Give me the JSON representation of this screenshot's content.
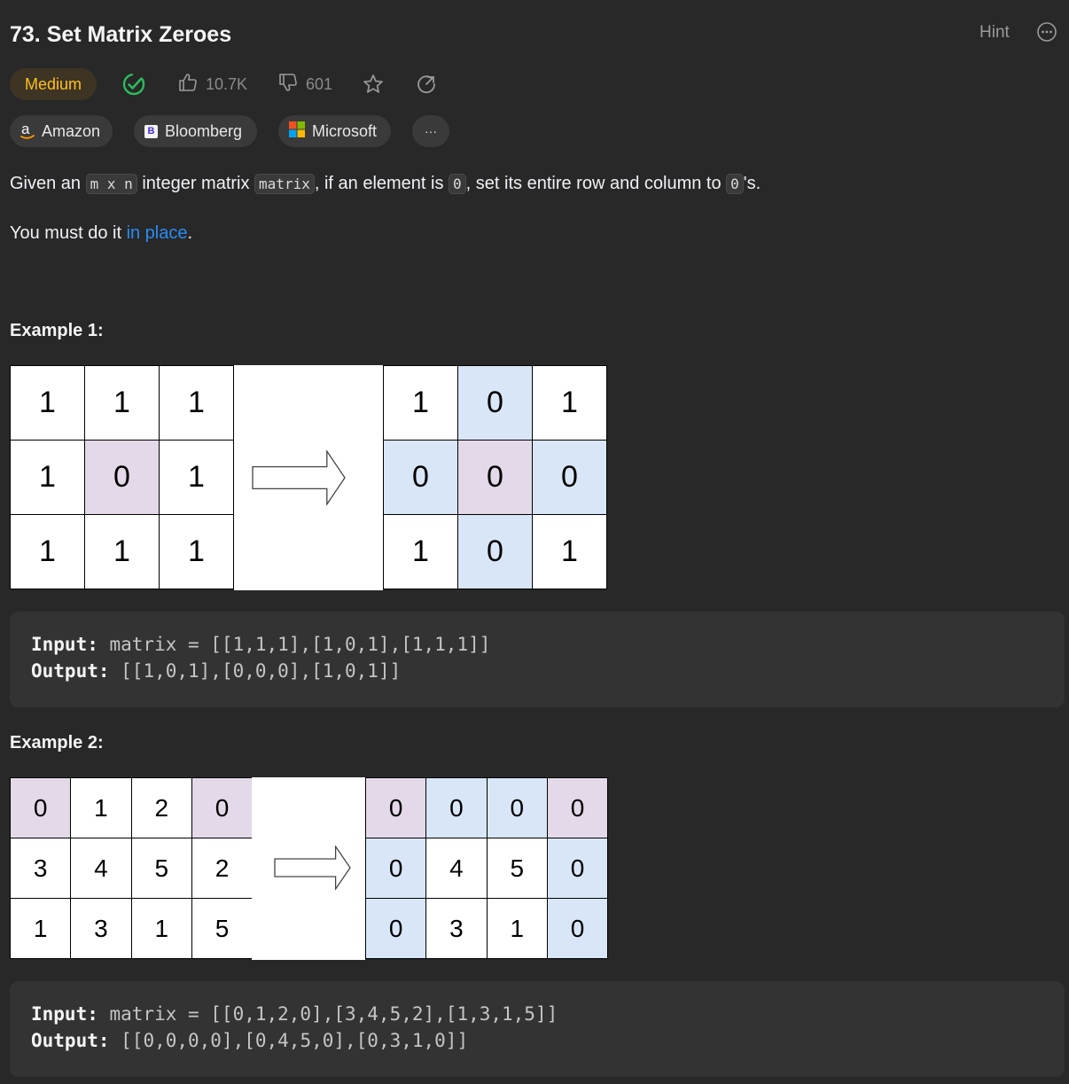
{
  "header": {
    "title": "73. Set Matrix Zeroes",
    "hint_label": "Hint",
    "more_icon": "more-options-icon"
  },
  "meta": {
    "difficulty": "Medium",
    "likes": "10.7K",
    "dislikes": "601"
  },
  "tags": [
    {
      "label": "Amazon",
      "icon": "a"
    },
    {
      "label": "Bloomberg",
      "icon": "B"
    },
    {
      "label": "Microsoft"
    },
    {
      "label": "···"
    }
  ],
  "description": {
    "p1": {
      "t1": "Given an ",
      "c1": "m x n",
      "t2": " integer matrix ",
      "c2": "matrix",
      "t3": ", if an element is ",
      "c3": "0",
      "t4": ", set its entire row and column to ",
      "c4": "0",
      "t5": "'s."
    },
    "p2": {
      "t1": "You must do it ",
      "link": "in place",
      "t2": "."
    }
  },
  "examples": [
    {
      "heading": "Example 1:",
      "input_label": "Input:",
      "input_value": " matrix = [[1,1,1],[1,0,1],[1,1,1]]",
      "output_label": "Output:",
      "output_value": " [[1,0,1],[0,0,0],[1,0,1]]",
      "before": [
        [
          "1",
          "1",
          "1"
        ],
        [
          "1",
          "0",
          "1"
        ],
        [
          "1",
          "1",
          "1"
        ]
      ],
      "after": [
        [
          "1",
          "0",
          "1"
        ],
        [
          "0",
          "0",
          "0"
        ],
        [
          "1",
          "0",
          "1"
        ]
      ]
    },
    {
      "heading": "Example 2:",
      "input_label": "Input:",
      "input_value": " matrix = [[0,1,2,0],[3,4,5,2],[1,3,1,5]]",
      "output_label": "Output:",
      "output_value": " [[0,0,0,0],[0,4,5,0],[0,3,1,0]]",
      "before": [
        [
          "0",
          "1",
          "2",
          "0"
        ],
        [
          "3",
          "4",
          "5",
          "2"
        ],
        [
          "1",
          "3",
          "1",
          "5"
        ]
      ],
      "after": [
        [
          "0",
          "0",
          "0",
          "0"
        ],
        [
          "0",
          "4",
          "5",
          "0"
        ],
        [
          "0",
          "3",
          "1",
          "0"
        ]
      ]
    }
  ],
  "colors": {
    "origin_zero": "#e3d9e9",
    "set_zero": "#d8e6f8",
    "difficulty": "#ffc01e",
    "link": "#2a8cf5",
    "solved": "#2cbb5d"
  }
}
